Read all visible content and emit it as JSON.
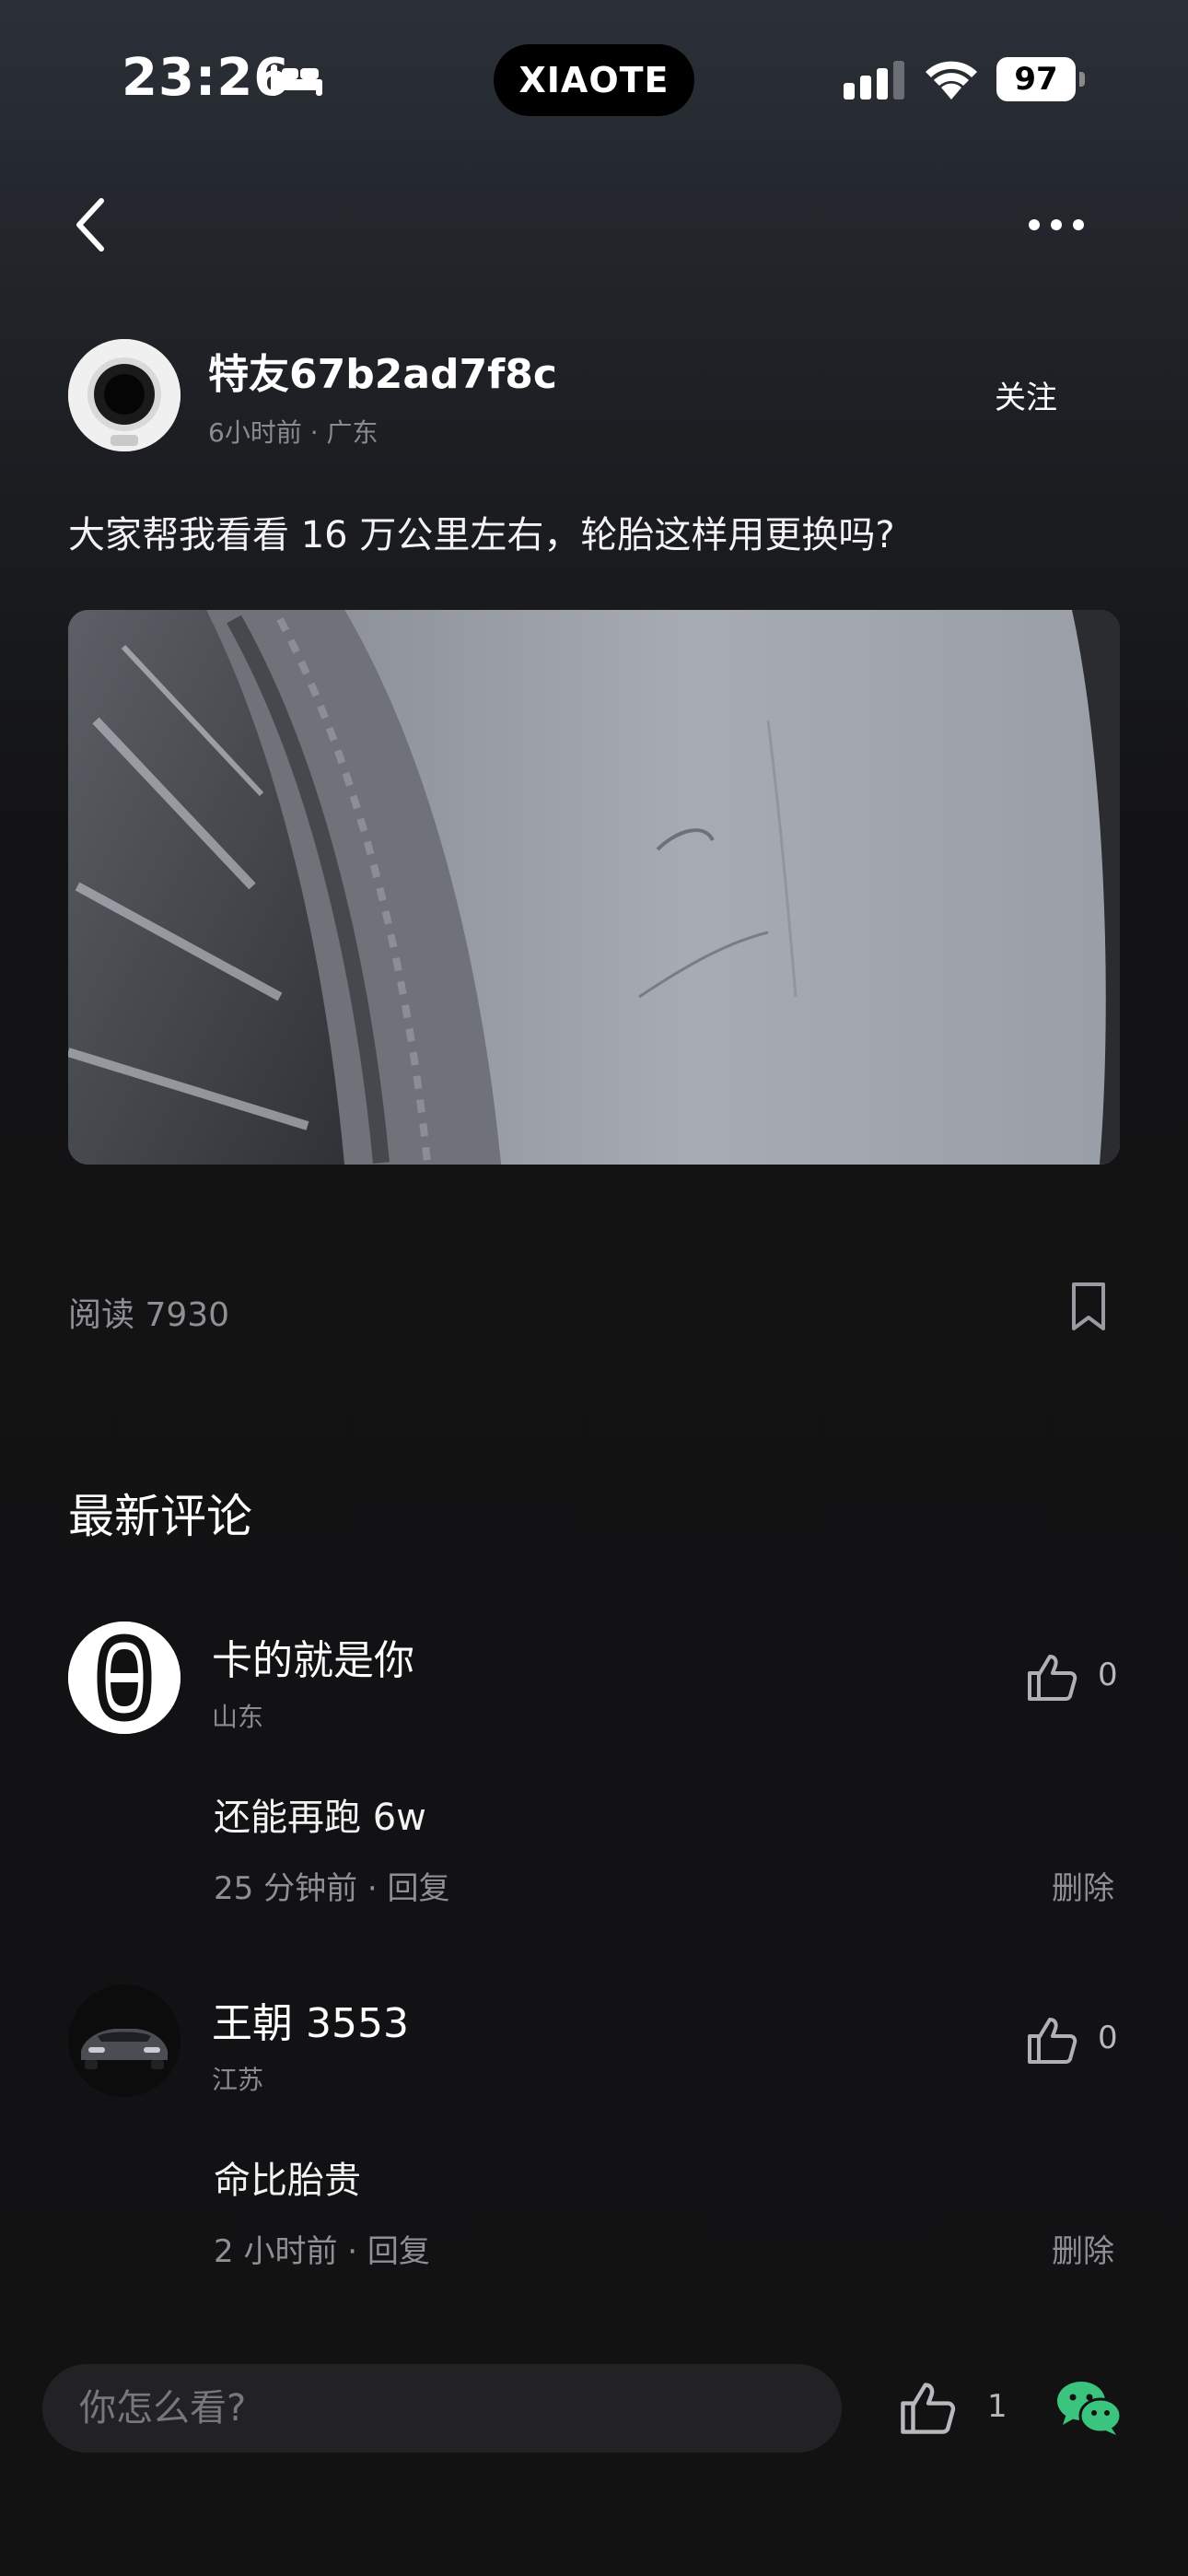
{
  "status_bar": {
    "time": "23:26",
    "island_label": "XIAOTE",
    "battery": "97"
  },
  "post": {
    "author_name": "特友67b2ad7f8c",
    "time_ago": "6小时前",
    "location": "广东",
    "follow_label": "关注",
    "text": "大家帮我看看 16 万公里左右，轮胎这样用更换吗?",
    "read_label": "阅读 7930"
  },
  "comments_section": {
    "title": "最新评论",
    "items": [
      {
        "name": "卡的就是你",
        "location": "山东",
        "likes": "0",
        "text": "还能再跑 6w",
        "meta": "25 分钟前 · 回复",
        "delete_label": "删除"
      },
      {
        "name": "王朝 3553",
        "location": "江苏",
        "likes": "0",
        "text": "命比胎贵",
        "meta": "2 小时前 · 回复",
        "delete_label": "删除"
      }
    ]
  },
  "bottom_bar": {
    "input_placeholder": "你怎么看?",
    "like_count": "1"
  },
  "colors": {
    "accent_green": "#3bc47e",
    "muted_text": "#8f9096"
  }
}
